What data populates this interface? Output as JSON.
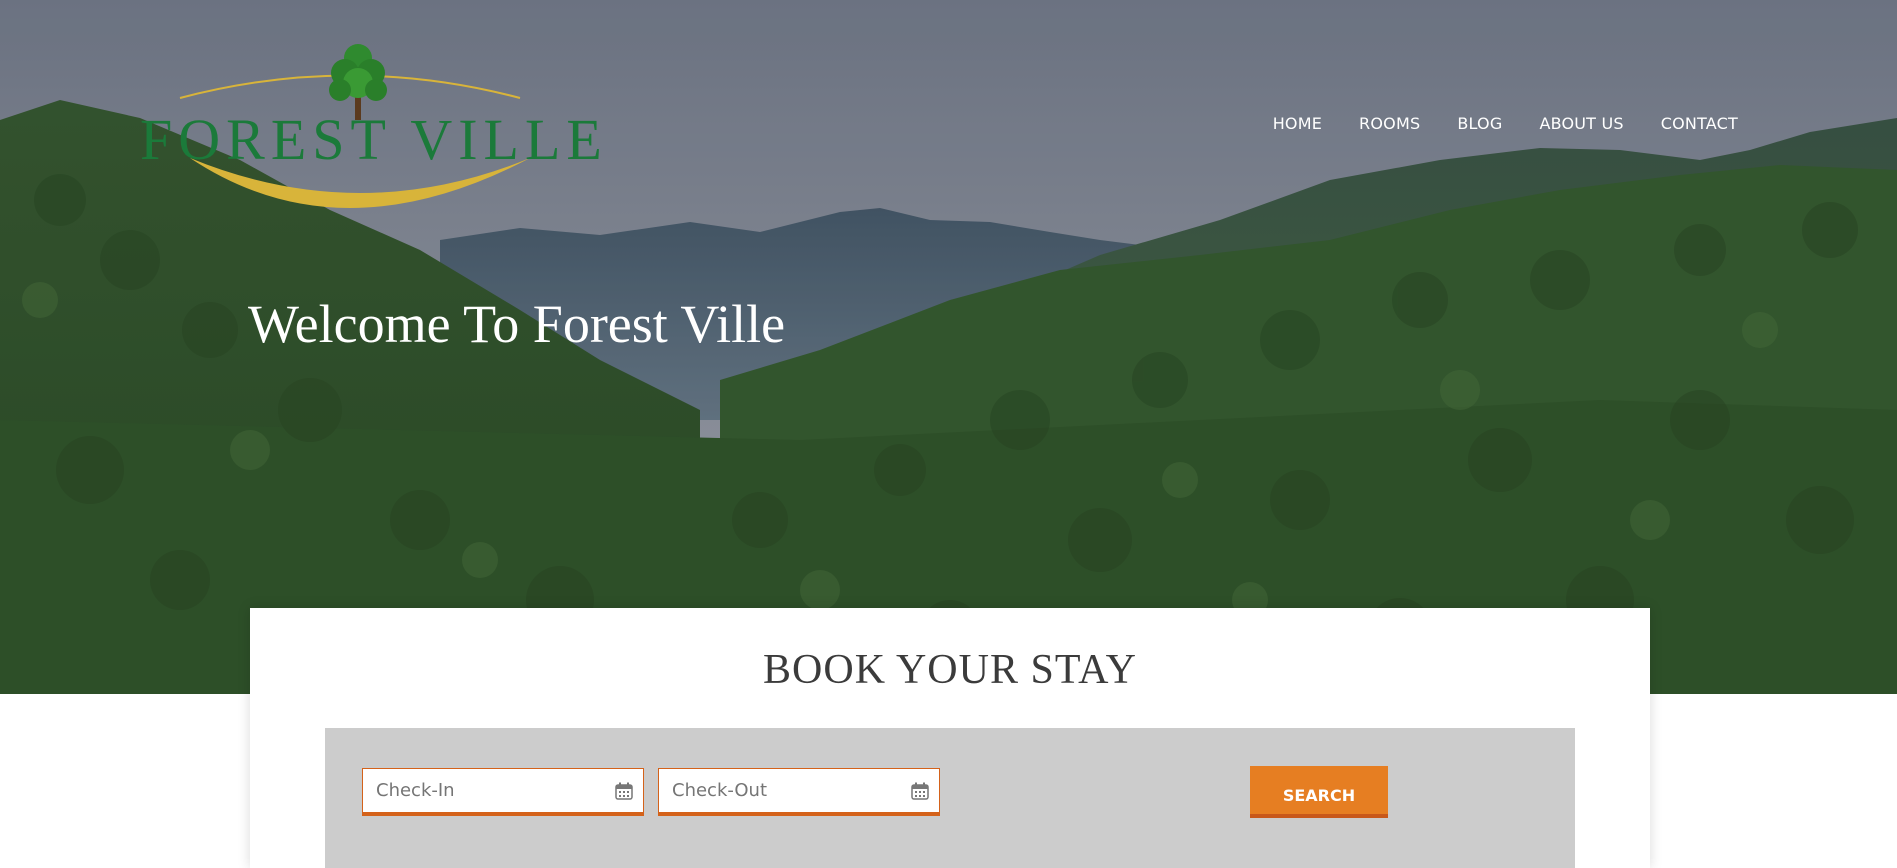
{
  "brand": {
    "name": "FOREST VILLE"
  },
  "nav": {
    "items": [
      {
        "label": "HOME"
      },
      {
        "label": "ROOMS"
      },
      {
        "label": "BLOG"
      },
      {
        "label": "ABOUT US"
      },
      {
        "label": "CONTACT"
      }
    ]
  },
  "hero": {
    "title": "Welcome To Forest Ville"
  },
  "booking": {
    "title": "BOOK YOUR STAY",
    "checkin_placeholder": "Check-In",
    "checkout_placeholder": "Check-Out",
    "search_label": "SEARCH"
  },
  "colors": {
    "accent": "#e67e22",
    "input_border": "#d4621a",
    "logo_green": "#1b7a3a",
    "logo_gold": "#d8b43a",
    "panel_gray": "#cccccc"
  },
  "icons": [
    "tree-icon",
    "calendar-icon"
  ]
}
